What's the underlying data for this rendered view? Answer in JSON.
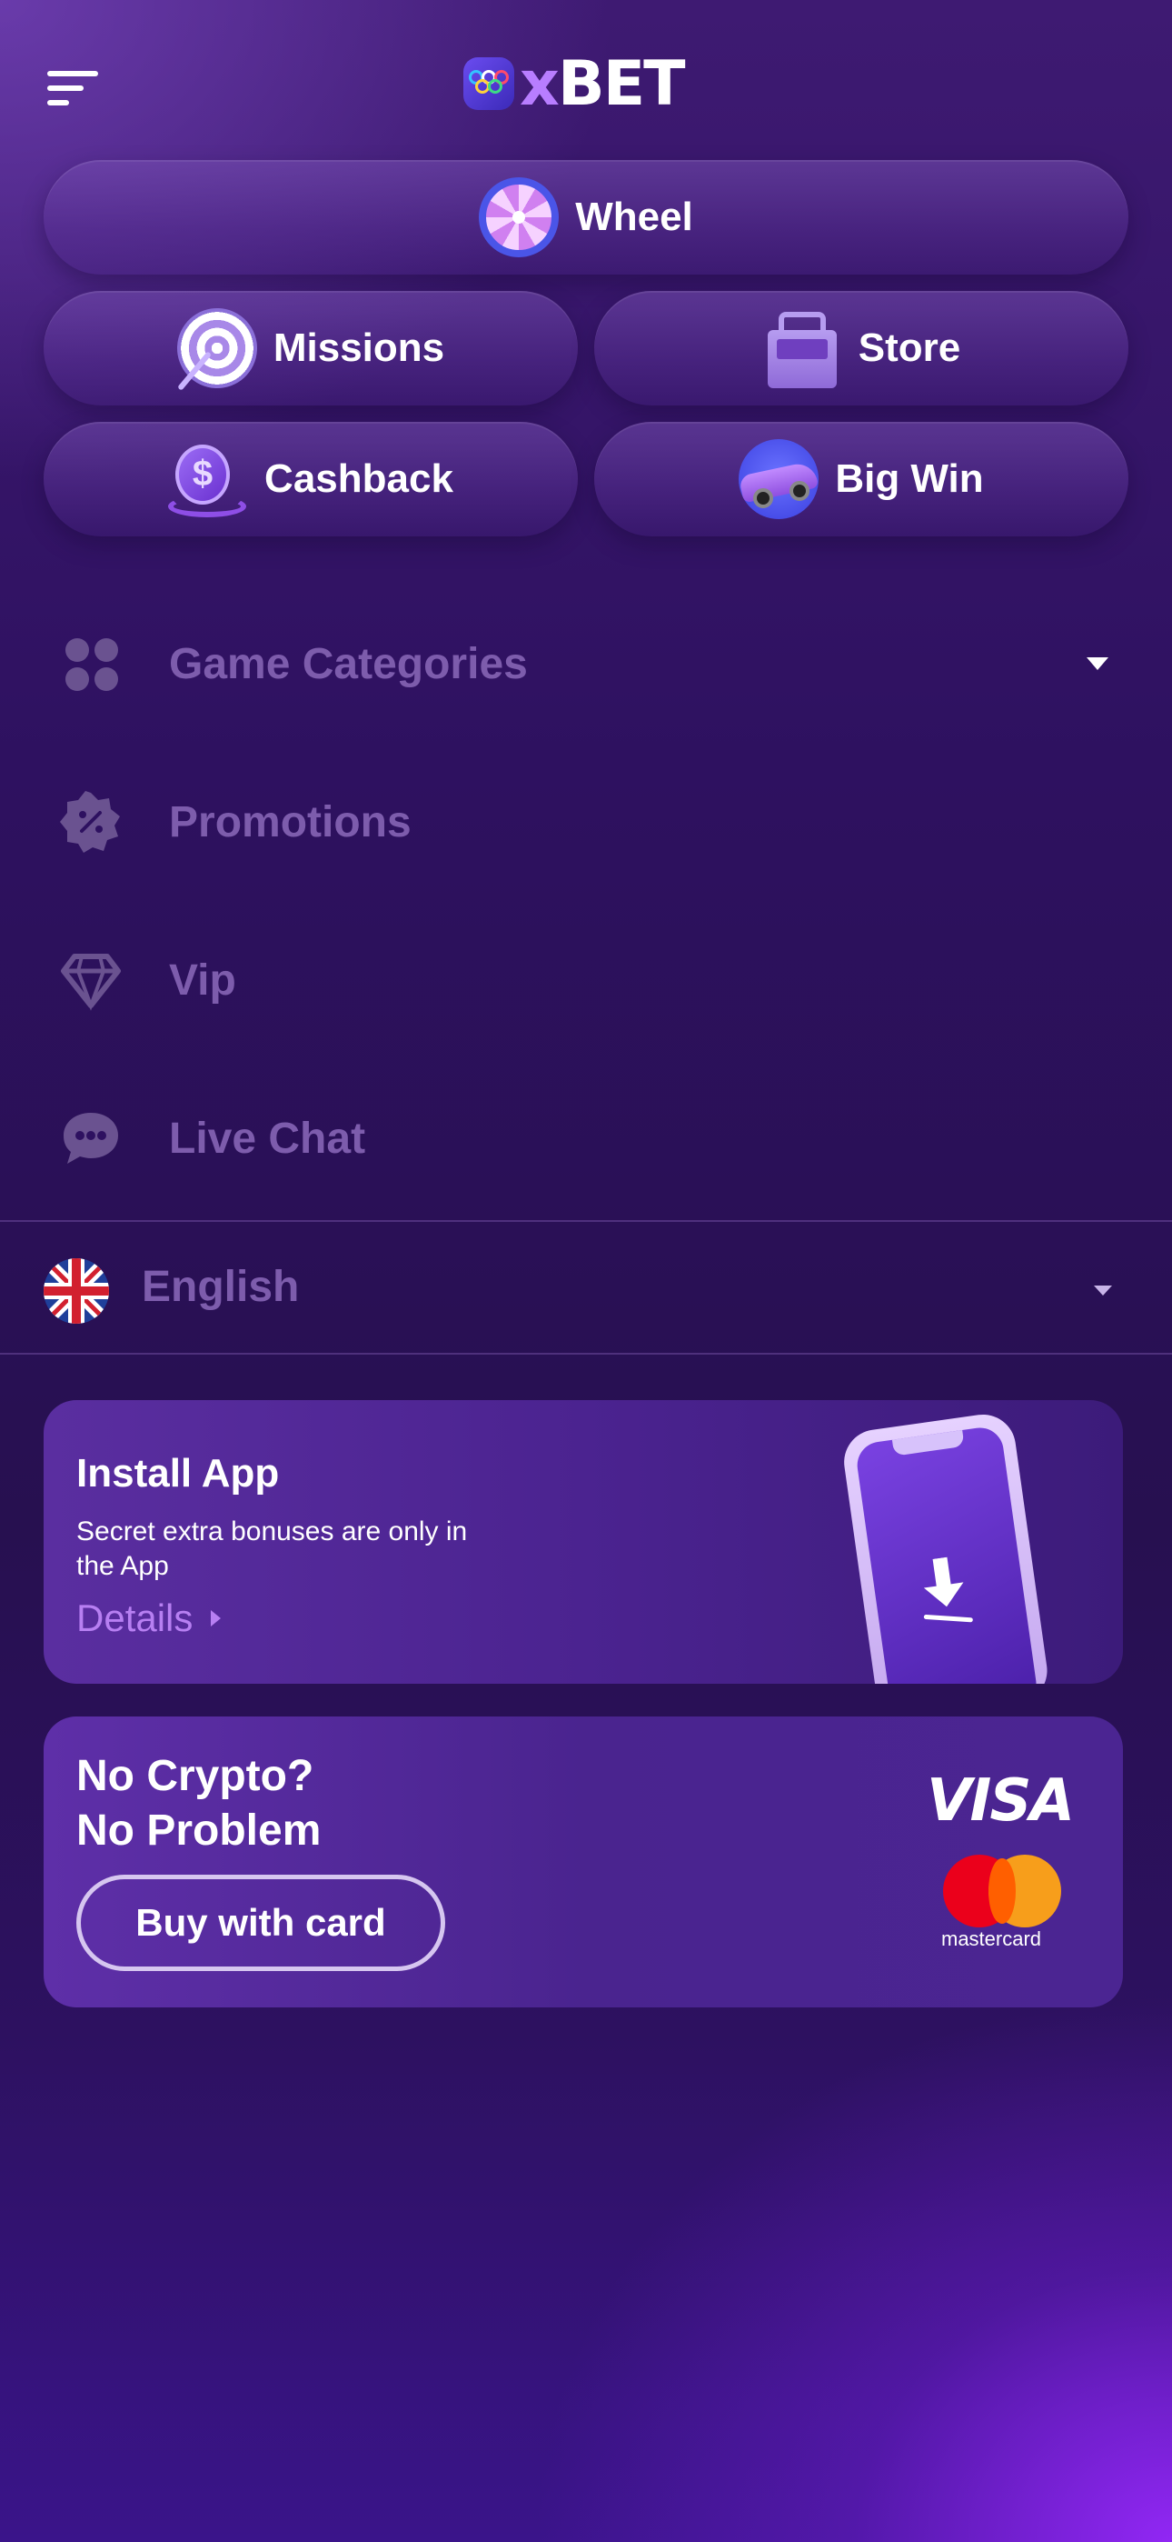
{
  "header": {
    "logo_prefix": "x",
    "logo_suffix": "BET"
  },
  "actions": {
    "wheel": "Wheel",
    "missions": "Missions",
    "store": "Store",
    "cashback": "Cashback",
    "big_win": "Big Win"
  },
  "menu": {
    "items": [
      {
        "label": "Game Categories",
        "icon": "grid-dots-icon"
      },
      {
        "label": "Promotions",
        "icon": "percent-badge-icon"
      },
      {
        "label": "Vip",
        "icon": "diamond-icon"
      },
      {
        "label": "Live Chat",
        "icon": "chat-bubble-icon"
      }
    ]
  },
  "language": {
    "label": "English",
    "flag": "uk-flag-icon"
  },
  "install_card": {
    "title": "Install App",
    "subtitle": "Secret extra bonuses are only in the App",
    "link": "Details"
  },
  "crypto_card": {
    "title_line1": "No Crypto?",
    "title_line2": "No Problem",
    "button": "Buy with card",
    "visa": "VISA",
    "mastercard": "mastercard"
  },
  "colors": {
    "accent": "#b77ff2",
    "muted_text": "#7d5cac"
  }
}
